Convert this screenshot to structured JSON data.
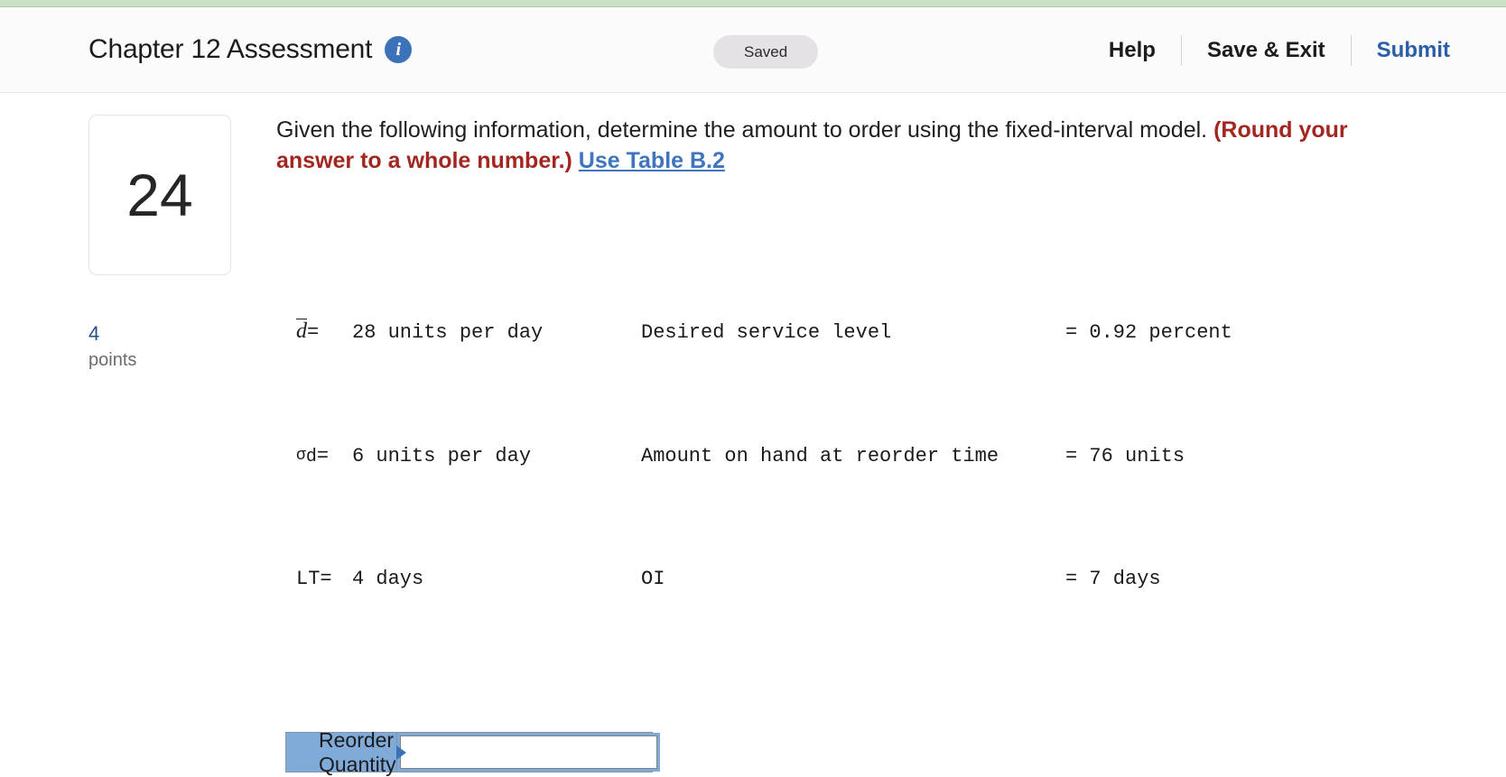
{
  "header": {
    "title": "Chapter 12 Assessment",
    "info_icon": "info-icon",
    "save_status": "Saved",
    "help_label": "Help",
    "save_exit_label": "Save & Exit",
    "submit_label": "Submit",
    "accent_blue": "#2a5ea8",
    "strip_color": "#cbe0c6"
  },
  "question": {
    "number": "24",
    "points_value": "4",
    "points_label": "points",
    "prompt_part1": "Given the following information, determine the amount to order using the fixed-interval model. ",
    "prompt_emphasis": "(Round your answer to a whole number.) ",
    "table_link": "Use Table B.2",
    "given": {
      "rows": [
        {
          "symbol_text": "d",
          "symbol_kind": "d-bar",
          "equals": "=",
          "value": "28 units per day",
          "desc": "Desired service level",
          "result": "= 0.92 percent"
        },
        {
          "symbol_text": "σd",
          "symbol_kind": "sigma-d",
          "equals": "=",
          "value": "6 units per day",
          "desc": "Amount on hand at reorder time",
          "result": "= 76 units"
        },
        {
          "symbol_text": "LT",
          "symbol_kind": "plain",
          "equals": "=",
          "value": "4 days",
          "desc": "OI",
          "result": "= 7 days"
        }
      ]
    },
    "answer": {
      "label": "Reorder Quantity",
      "value": "",
      "placeholder": ""
    }
  }
}
